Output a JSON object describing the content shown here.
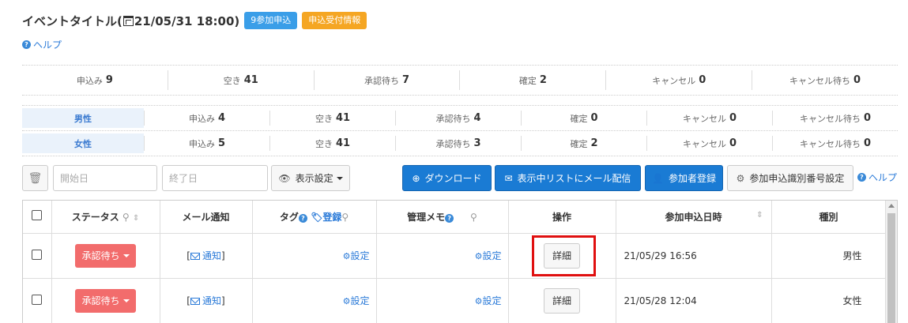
{
  "event": {
    "title": "イベントタイトル(",
    "datetime": "21/05/31 18:00)",
    "badge_entries": "9参加申込",
    "badge_info": "申込受付情報",
    "help": "ヘルプ"
  },
  "summary": [
    {
      "label": "申込み",
      "value": "9"
    },
    {
      "label": "空き",
      "value": "41"
    },
    {
      "label": "承認待ち",
      "value": "7"
    },
    {
      "label": "確定",
      "value": "2"
    },
    {
      "label": "キャンセル",
      "value": "0"
    },
    {
      "label": "キャンセル待ち",
      "value": "0"
    }
  ],
  "gender_stats": {
    "male": {
      "label": "男性",
      "cells": [
        {
          "label": "申込み",
          "value": "4"
        },
        {
          "label": "空き",
          "value": "41"
        },
        {
          "label": "承認待ち",
          "value": "4"
        },
        {
          "label": "確定",
          "value": "0"
        },
        {
          "label": "キャンセル",
          "value": "0"
        },
        {
          "label": "キャンセル待ち",
          "value": "0"
        }
      ]
    },
    "female": {
      "label": "女性",
      "cells": [
        {
          "label": "申込み",
          "value": "5"
        },
        {
          "label": "空き",
          "value": "41"
        },
        {
          "label": "承認待ち",
          "value": "3"
        },
        {
          "label": "確定",
          "value": "2"
        },
        {
          "label": "キャンセル",
          "value": "0"
        },
        {
          "label": "キャンセル待ち",
          "value": "0"
        }
      ]
    }
  },
  "toolbar": {
    "start_placeholder": "開始日",
    "end_placeholder": "終了日",
    "display_settings": "表示設定",
    "download": "ダウンロード",
    "mail_list": "表示中リストにメール配信",
    "register_participant": "参加者登録",
    "id_settings": "参加申込識別番号設定",
    "help": "ヘルプ"
  },
  "table": {
    "headers": {
      "status": "ステータス",
      "mail": "メール通知",
      "tag": "タグ",
      "tag_register": "登録",
      "memo": "管理メモ",
      "action": "操作",
      "applied_at": "参加申込日時",
      "type": "種別"
    },
    "rows": [
      {
        "status": "承認待ち",
        "mail": "[",
        "mail_link": "通知",
        "mail_close": "]",
        "tag_setting": "設定",
        "memo_setting": "設定",
        "action": "詳細",
        "applied_at": "21/05/29 16:56",
        "type": "男性"
      },
      {
        "status": "承認待ち",
        "mail": "[",
        "mail_link": "通知",
        "mail_close": "]",
        "tag_setting": "設定",
        "memo_setting": "設定",
        "action": "詳細",
        "applied_at": "21/05/28 12:04",
        "type": "女性"
      }
    ]
  },
  "colors": {
    "primary": "#1a7bd4",
    "status_red": "#f26c6c",
    "badge_blue": "#3a9ee8",
    "badge_orange": "#f5a623",
    "highlight": "#e01010"
  }
}
